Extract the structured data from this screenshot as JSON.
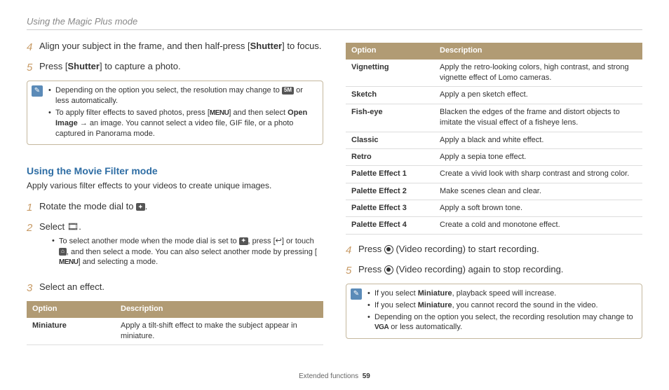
{
  "header": {
    "title": "Using the Magic Plus mode"
  },
  "left": {
    "step4": {
      "num": "4",
      "pre": "Align your subject in the frame, and then half-press [",
      "bold": "Shutter",
      "post": "] to focus."
    },
    "step5": {
      "num": "5",
      "pre": "Press [",
      "bold": "Shutter",
      "post": "] to capture a photo."
    },
    "note1": {
      "a_pre": "Depending on the option you select, the resolution may change to ",
      "a_badge": "5M",
      "a_post": " or less automatically.",
      "b_pre": "To apply filter effects to saved photos, press [",
      "b_menu": "MENU",
      "b_mid": "] and then select ",
      "b_bold": "Open Image",
      "b_post": " → an image. You cannot select a video file, GIF file, or a photo captured in Panorama mode."
    },
    "section": {
      "title": "Using the Movie Filter mode",
      "sub": "Apply various filter effects to your videos to create unique images."
    },
    "mstep1": {
      "num": "1",
      "pre": "Rotate the mode dial to ",
      "icon_name": "mode-dial-magic-icon",
      "post": "."
    },
    "mstep2": {
      "num": "2",
      "text": "Select ",
      "icon_name": "movie-filter-icon",
      "post": ".",
      "sub_pre": "To select another mode when the mode dial is set to ",
      "sub_icon1": "mode-dial-magic-icon",
      "sub_mid1": ", press [",
      "sub_icon2": "back-icon",
      "sub_mid2": "] or touch ",
      "sub_icon3": "home-icon",
      "sub_mid3": ", and then select a mode. You can also select another mode by pressing [",
      "sub_menu": "MENU",
      "sub_post": "] and selecting a mode."
    },
    "mstep3": {
      "num": "3",
      "text": "Select an effect."
    },
    "table1": {
      "h1": "Option",
      "h2": "Description",
      "r1c1": "Miniature",
      "r1c2": "Apply a tilt-shift effect to make the subject appear in miniature."
    }
  },
  "right": {
    "table": {
      "h1": "Option",
      "h2": "Description",
      "rows": [
        {
          "c1": "Vignetting",
          "c2": "Apply the retro-looking colors, high contrast, and strong vignette effect of Lomo cameras."
        },
        {
          "c1": "Sketch",
          "c2": "Apply a pen sketch effect."
        },
        {
          "c1": "Fish-eye",
          "c2": "Blacken the edges of the frame and distort objects to imitate the visual effect of a fisheye lens."
        },
        {
          "c1": "Classic",
          "c2": "Apply a black and white effect."
        },
        {
          "c1": "Retro",
          "c2": "Apply a sepia tone effect."
        },
        {
          "c1": "Palette Effect 1",
          "c2": "Create a vivid look with sharp contrast and strong color."
        },
        {
          "c1": "Palette Effect 2",
          "c2": "Make scenes clean and clear."
        },
        {
          "c1": "Palette Effect 3",
          "c2": "Apply a soft brown tone."
        },
        {
          "c1": "Palette Effect 4",
          "c2": "Create a cold and monotone effect."
        }
      ]
    },
    "step4": {
      "num": "4",
      "pre": "Press ",
      "post": " (Video recording) to start recording."
    },
    "step5": {
      "num": "5",
      "pre": "Press ",
      "post": " (Video recording) again to stop recording."
    },
    "note2": {
      "a_pre": "If you select ",
      "a_bold": "Miniature",
      "a_post": ", playback speed will increase.",
      "b_pre": "If you select ",
      "b_bold": "Miniature",
      "b_post": ", you cannot record the sound in the video.",
      "c_pre": "Depending on the option you select, the recording resolution may change to ",
      "c_badge": "VGA",
      "c_post": " or less automatically."
    }
  },
  "footer": {
    "section": "Extended functions",
    "page": "59"
  }
}
